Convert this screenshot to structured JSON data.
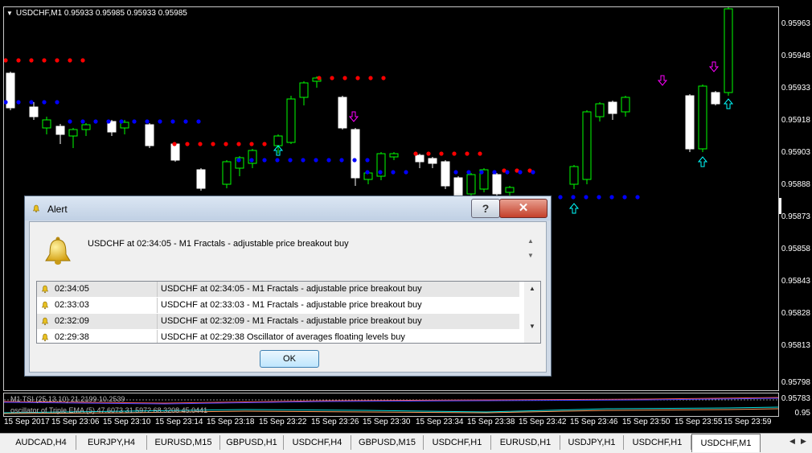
{
  "chart": {
    "title": "USDCHF,M1  0.95933 0.95985 0.95933 0.95985",
    "price_levels": [
      "0.95963",
      "0.95948",
      "0.95933",
      "0.95918",
      "0.95903",
      "0.95888",
      "0.95873",
      "0.95858",
      "0.95843",
      "0.95828",
      "0.95813",
      "0.95798",
      "0.95783",
      "0.95"
    ],
    "time_labels": [
      "15 Sep 2017",
      "15 Sep 23:06",
      "15 Sep 23:10",
      "15 Sep 23:14",
      "15 Sep 23:18",
      "15 Sep 23:22",
      "15 Sep 23:26",
      "15 Sep 23:30",
      "15 Sep 23:34",
      "15 Sep 23:38",
      "15 Sep 23:42",
      "15 Sep 23:46",
      "15 Sep 23:50",
      "15 Sep 23:55",
      "15 Sep 23:59"
    ],
    "indicator_labels": [
      "M1 TSI (25,13,10) 21.2199 10.2539",
      "oscillator of Triple EMA (5) 47.6073 31.5972 68.3208 45.0441"
    ],
    "colors": {
      "bull_candle": "#00ff00",
      "bear_candle": "#ffffff",
      "resistance_dots": "#ff0000",
      "support_dots": "#0000ff",
      "up_arrow": "#00ffff",
      "down_arrow": "#ff00ff"
    }
  },
  "alert": {
    "title": "Alert",
    "help_glyph": "?",
    "close_glyph": "✕",
    "message": "USDCHF at 02:34:05 - M1 Fractals - adjustable price breakout buy",
    "rows": [
      {
        "time": "02:34:05",
        "message": "USDCHF at 02:34:05 - M1 Fractals - adjustable price breakout buy"
      },
      {
        "time": "02:33:03",
        "message": "USDCHF at 02:33:03 - M1 Fractals - adjustable price breakout buy"
      },
      {
        "time": "02:32:09",
        "message": "USDCHF at 02:32:09 - M1 Fractals - adjustable price breakout buy"
      },
      {
        "time": "02:29:38",
        "message": "USDCHF at 02:29:38 Oscillator of averages floating levels buy"
      }
    ],
    "ok_label": "OK"
  },
  "tabs": [
    "AUDCAD,H4",
    "EURJPY,H4",
    "EURUSD,M15",
    "GBPUSD,H1",
    "USDCHF,H4",
    "GBPUSD,M15",
    "USDCHF,H1",
    "EURUSD,H1",
    "USDJPY,H1",
    "USDCHF,H1",
    "USDCHF,M1"
  ],
  "active_tab": "USDCHF,M1"
}
